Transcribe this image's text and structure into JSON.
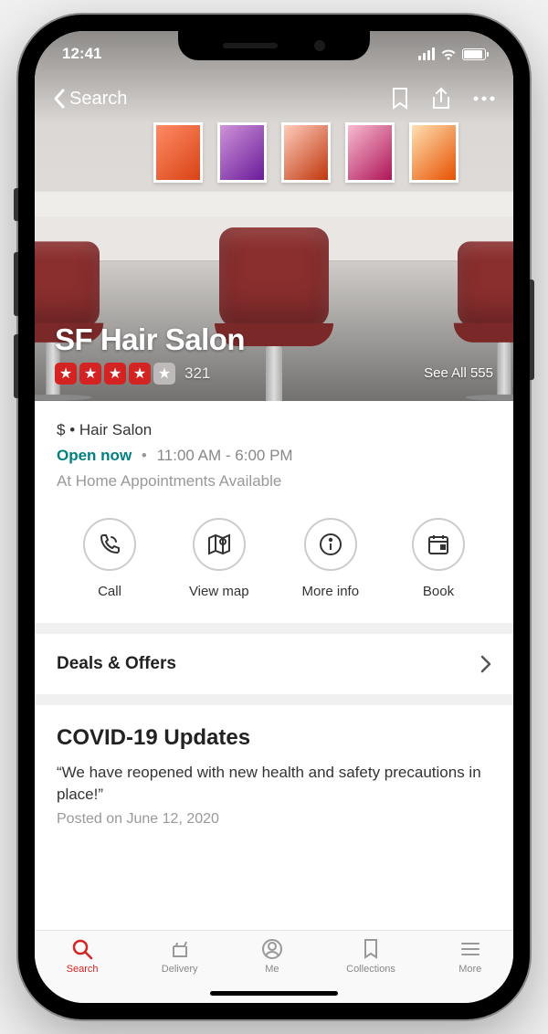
{
  "status": {
    "time": "12:41"
  },
  "nav": {
    "back_label": "Search"
  },
  "business": {
    "name": "SF Hair Salon",
    "rating_filled": 4,
    "rating_empty": 1,
    "review_count": "321",
    "see_all_label": "See All 555",
    "price": "$",
    "category": "Hair Salon",
    "open_label": "Open now",
    "hours": "11:00 AM - 6:00 PM",
    "service_note": "At Home Appointments Available"
  },
  "actions": {
    "call": "Call",
    "view_map": "View map",
    "more_info": "More info",
    "book": "Book"
  },
  "deals": {
    "title": "Deals & Offers"
  },
  "covid": {
    "title": "COVID-19 Updates",
    "quote": "“We have reopened with new health and safety precautions in place!”",
    "posted": "Posted on June 12, 2020"
  },
  "tabs": {
    "search": "Search",
    "delivery": "Delivery",
    "me": "Me",
    "collections": "Collections",
    "more": "More"
  }
}
